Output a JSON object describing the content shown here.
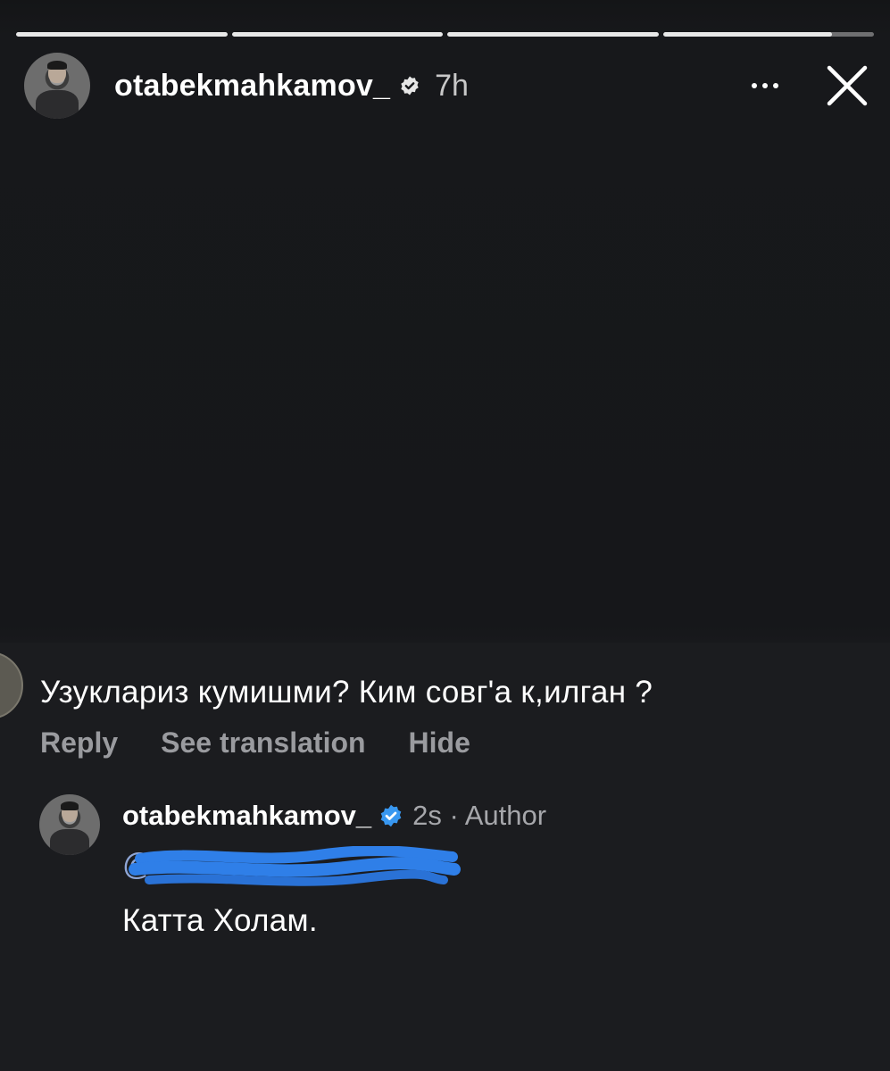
{
  "story": {
    "segments": [
      {
        "progress": 1.0
      },
      {
        "progress": 1.0
      },
      {
        "progress": 1.0
      },
      {
        "progress": 0.8
      }
    ],
    "username": "otabekmahkamov_",
    "time": "7h",
    "icons": {
      "verified": "verified-badge-icon",
      "more": "more-icon",
      "close": "close-icon"
    }
  },
  "comment": {
    "text": "Узуклариз кумишми? Ким совг'а к,илган ?",
    "actions": {
      "reply": "Reply",
      "see_translation": "See translation",
      "hide": "Hide"
    }
  },
  "reply": {
    "username": "otabekmahkamov_",
    "time_author": "2s · Author",
    "mention_prefix": "@",
    "text": "Катта Холам."
  },
  "colors": {
    "background": "#16171a",
    "verified_blue": "#3897f0",
    "redaction_blue": "#2f7fe8",
    "muted_text": "#9a9b9f"
  }
}
